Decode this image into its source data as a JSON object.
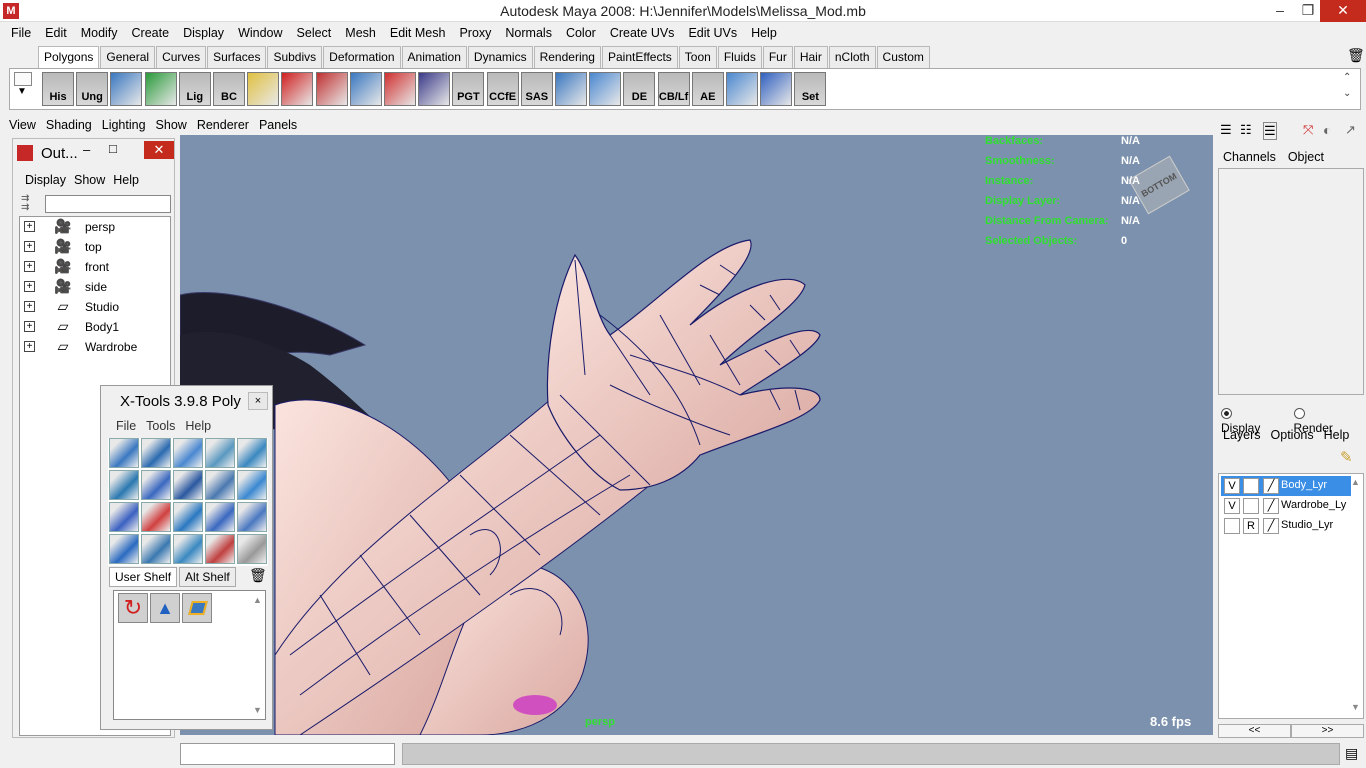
{
  "window": {
    "title": "Autodesk Maya 2008: H:\\Jennifer\\Models\\Melissa_Mod.mb",
    "app_icon": "maya-icon",
    "min": "–",
    "max": "❐",
    "close": "✕"
  },
  "menubar": [
    "File",
    "Edit",
    "Modify",
    "Create",
    "Display",
    "Window",
    "Select",
    "Mesh",
    "Edit Mesh",
    "Proxy",
    "Normals",
    "Color",
    "Create UVs",
    "Edit UVs",
    "Help"
  ],
  "shelf_tabs": [
    "Polygons",
    "General",
    "Curves",
    "Surfaces",
    "Subdivs",
    "Deformation",
    "Animation",
    "Dynamics",
    "Rendering",
    "PaintEffects",
    "Toon",
    "Fluids",
    "Fur",
    "Hair",
    "nCloth",
    "Custom"
  ],
  "shelf_tab_active": "Polygons",
  "shelf_icons": [
    "His",
    "Ung",
    "",
    "",
    "Lig",
    "BC",
    "",
    "",
    "",
    "",
    "",
    "",
    "PGT",
    "CCfE",
    "SAS",
    "",
    "",
    "DE",
    "CB/Lf",
    "AE",
    "",
    "",
    "Set"
  ],
  "panel_menu": [
    "View",
    "Shading",
    "Lighting",
    "Show",
    "Renderer",
    "Panels"
  ],
  "hud": {
    "rows": [
      {
        "label": "Backfaces:",
        "value": "N/A"
      },
      {
        "label": "Smoothness:",
        "value": "N/A"
      },
      {
        "label": "Instance:",
        "value": "N/A"
      },
      {
        "label": "Display Layer:",
        "value": "N/A"
      },
      {
        "label": "Distance From Camera:",
        "value": "N/A"
      },
      {
        "label": "Selected Objects:",
        "value": "0"
      }
    ],
    "fps": "8.6 fps",
    "camera": "persp",
    "view_cube": "BOTTOM"
  },
  "outliner": {
    "title": "Out...",
    "min": "–",
    "max": "□",
    "close": "✕",
    "menu": [
      "Display",
      "Show",
      "Help"
    ],
    "items": [
      {
        "label": "persp",
        "icon": "camera-icon"
      },
      {
        "label": "top",
        "icon": "camera-icon"
      },
      {
        "label": "front",
        "icon": "camera-icon"
      },
      {
        "label": "side",
        "icon": "camera-icon"
      },
      {
        "label": "Studio",
        "icon": "layer-set-icon"
      },
      {
        "label": "Body1",
        "icon": "layer-set-icon"
      },
      {
        "label": "Wardrobe",
        "icon": "layer-set-icon"
      }
    ],
    "expand": "+"
  },
  "xtools": {
    "title": "X-Tools 3.9.8 Poly",
    "close": "×",
    "menu": [
      "File",
      "Tools",
      "Help"
    ],
    "tabs": [
      "User Shelf",
      "Alt Shelf"
    ],
    "active_tab": "User Shelf"
  },
  "right_panel": {
    "tabs": [
      "Channels",
      "Object"
    ],
    "radios": [
      {
        "label": "Display",
        "on": true
      },
      {
        "label": "Render",
        "on": false
      }
    ],
    "layer_menu": [
      "Layers",
      "Options",
      "Help"
    ],
    "layers": [
      {
        "v": "V",
        "p": "",
        "name": "Body_Lyr",
        "selected": true
      },
      {
        "v": "V",
        "p": "",
        "name": "Wardrobe_Ly",
        "selected": false
      },
      {
        "v": "",
        "p": "R",
        "name": "Studio_Lyr",
        "selected": false
      }
    ],
    "arrows": [
      "<<",
      ">>"
    ]
  },
  "colors": {
    "viewport": "#7b91ad",
    "hud_label": "#30e030",
    "skin": "#f0c8c0",
    "wire": "#1a1a6a",
    "hair": "#1c1c2a",
    "selection": "#3a8ee6"
  }
}
